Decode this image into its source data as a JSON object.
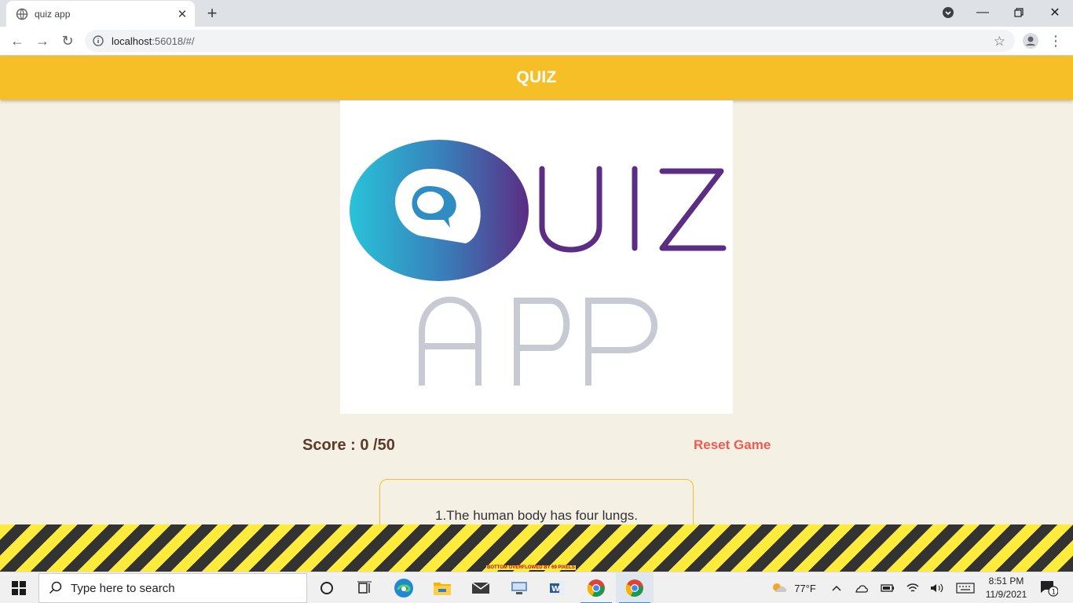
{
  "browser": {
    "tab_title": "quiz app",
    "url_host": "localhost",
    "url_rest": ":56018/#/"
  },
  "app": {
    "title": "QUIZ",
    "logo": {
      "word_top": "UIZ",
      "word_bottom": "APP"
    },
    "score_label": "Score : 0 /50",
    "reset_label": "Reset Game",
    "question_text": "1.The human body has four lungs.",
    "overflow_warning": "BOTTOM OVERFLOWED BY 69 PIXELS"
  },
  "taskbar": {
    "search_placeholder": "Type here to search",
    "weather": "77°F",
    "time": "8:51 PM",
    "date": "11/9/2021",
    "notification_count": "1"
  },
  "colors": {
    "appbar": "#f7bf27",
    "background": "#f4f1e4",
    "score_text": "#5b3a2c",
    "reset_text": "#f05a52",
    "logo_purple": "#5b2d83",
    "logo_cyan": "#28c3d9",
    "logo_gray": "#c7c9d3"
  }
}
